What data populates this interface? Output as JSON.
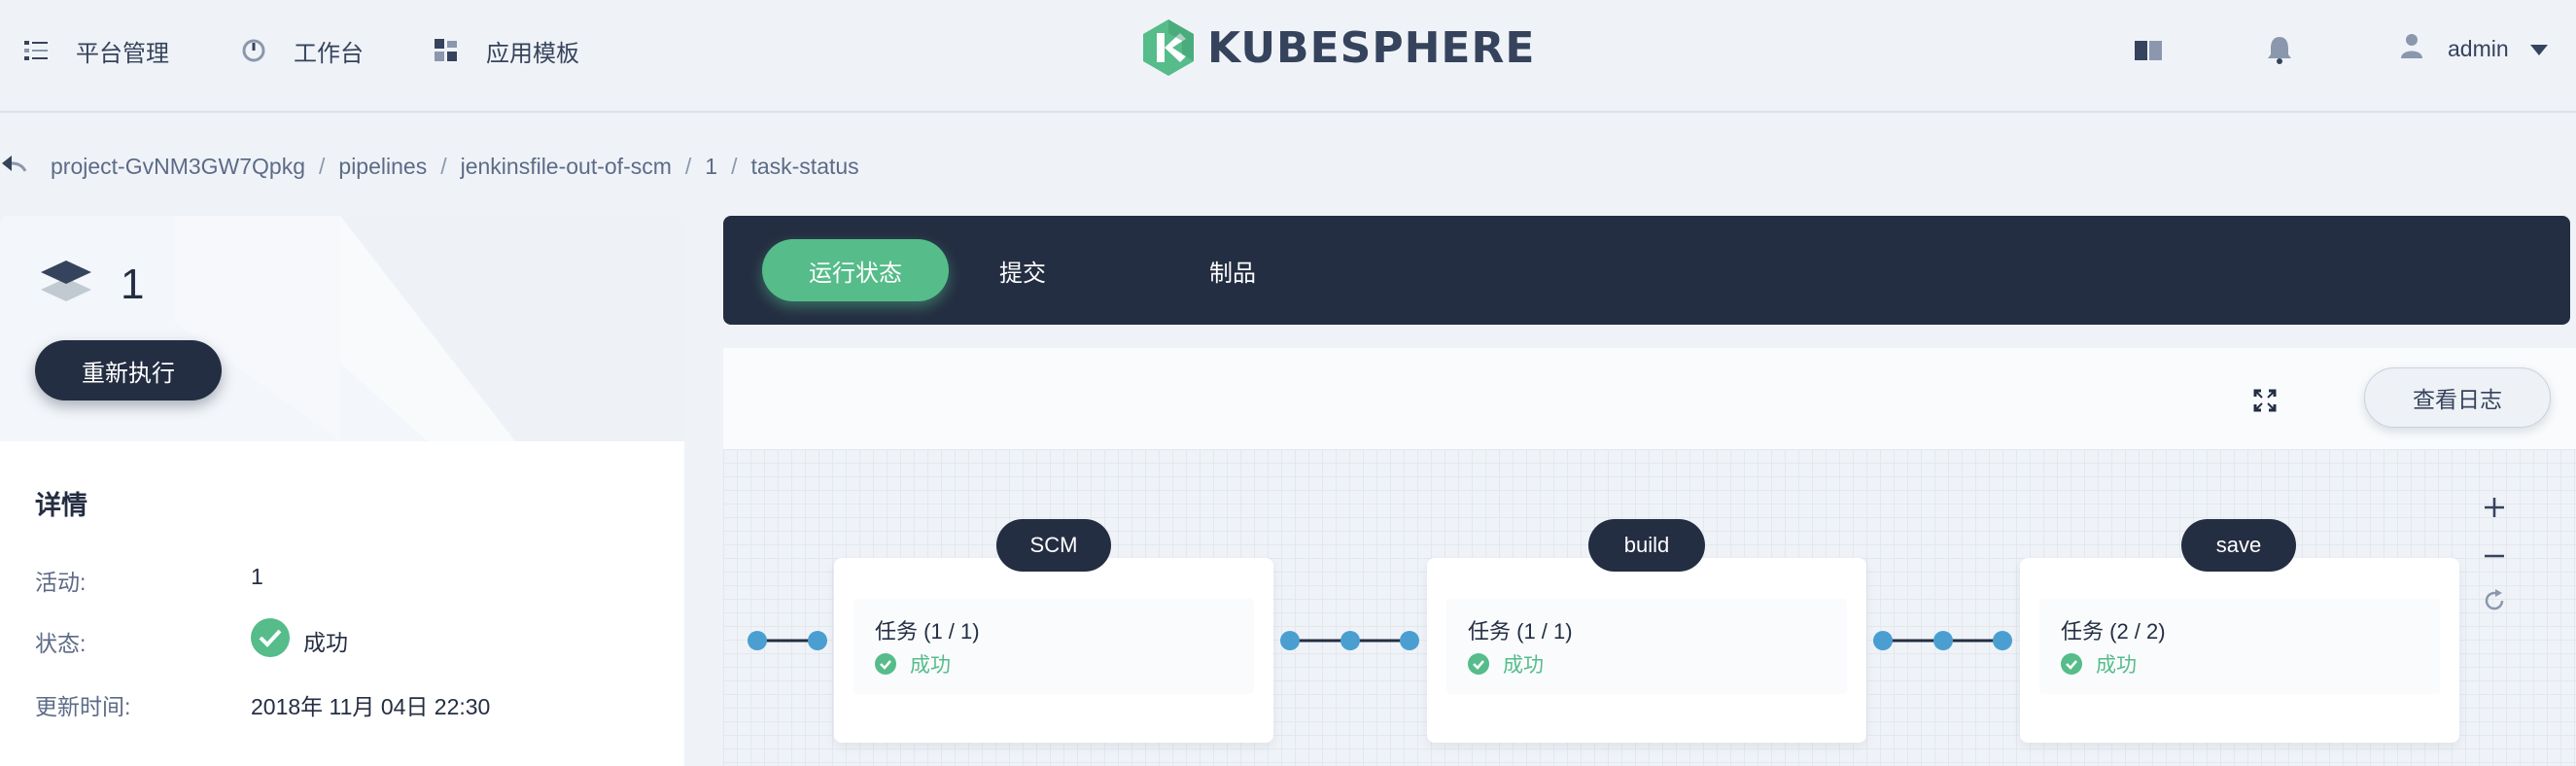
{
  "topbar": {
    "nav": [
      {
        "label": "平台管理",
        "icon": "list-icon"
      },
      {
        "label": "工作台",
        "icon": "dashboard-icon"
      },
      {
        "label": "应用模板",
        "icon": "apps-icon"
      }
    ],
    "logo_text": "KUBESPHERE",
    "user_name": "admin"
  },
  "breadcrumb": {
    "items": [
      "project-GvNM3GW7Qpkg",
      "pipelines",
      "jenkinsfile-out-of-scm",
      "1",
      "task-status"
    ]
  },
  "run": {
    "id": "1",
    "rerun_label": "重新执行"
  },
  "details": {
    "title": "详情",
    "rows": [
      {
        "label": "活动:",
        "value": "1"
      },
      {
        "label": "状态:",
        "value": "成功"
      },
      {
        "label": "更新时间:",
        "value": "2018年 11月 04日 22:30"
      }
    ]
  },
  "tabs": [
    "运行状态",
    "提交",
    "制品"
  ],
  "toolbar": {
    "log_label": "查看日志"
  },
  "stages": [
    {
      "name": "SCM",
      "task": "任务 (1 / 1)",
      "status": "成功"
    },
    {
      "name": "build",
      "task": "任务 (1 / 1)",
      "status": "成功"
    },
    {
      "name": "save",
      "task": "任务 (2 / 2)",
      "status": "成功"
    }
  ],
  "colors": {
    "dark": "#242e42",
    "success": "#55bc8a",
    "node": "#4a9fd0"
  }
}
